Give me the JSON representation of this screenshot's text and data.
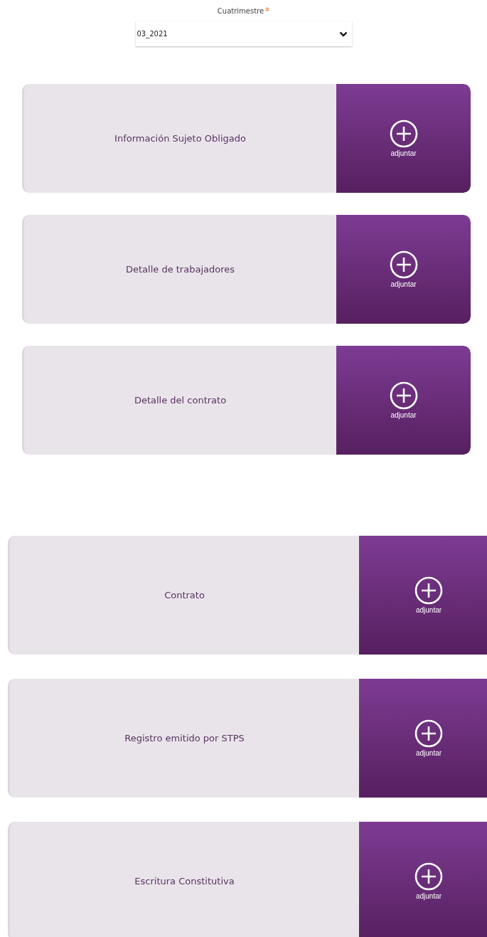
{
  "period_field": {
    "label": "Cuatrimestre",
    "required": true,
    "value": "03_2021"
  },
  "sections": [
    {
      "kind": "inset",
      "cards": [
        {
          "title": "Información Sujeto Obligado",
          "button": "adjuntar"
        },
        {
          "title": "Detalle de trabajadores",
          "button": "adjuntar"
        },
        {
          "title": "Detalle del contrato",
          "button": "adjuntar"
        }
      ]
    },
    {
      "kind": "wide",
      "cards": [
        {
          "title": "Contrato",
          "button": "adjuntar"
        },
        {
          "title": "Registro emitido por STPS",
          "button": "adjuntar"
        },
        {
          "title": "Escritura Constitutiva",
          "button": "adjuntar"
        }
      ]
    }
  ]
}
